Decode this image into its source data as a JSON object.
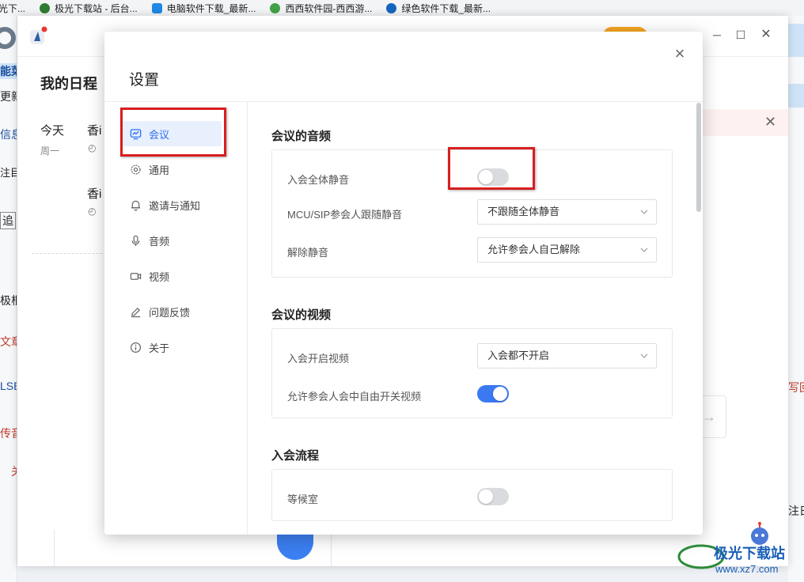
{
  "bookmarks": [
    {
      "label": "光下...",
      "color": "#f0b429"
    },
    {
      "label": "极光下载站 - 后台...",
      "color": "#2e7d32"
    },
    {
      "label": "电脑软件下载_最新...",
      "color": "#1e88e5"
    },
    {
      "label": "西西软件园-西西游...",
      "color": "#43a047"
    },
    {
      "label": "绿色软件下载_最新...",
      "color": "#1565c0"
    }
  ],
  "background": {
    "left_fragments": [
      "能菜",
      "更新",
      "信息",
      "注目.",
      "追",
      "极根",
      "文章",
      "LSE",
      "传音",
      "关"
    ],
    "right_fragments": [
      "写回",
      "注日打"
    ],
    "app": {
      "heading": "我的日程",
      "today": "今天",
      "weekday": "周一",
      "events": [
        "香i",
        "香i"
      ]
    }
  },
  "dialog": {
    "title": "设置",
    "nav": [
      {
        "label": "会议",
        "icon": "meeting-icon",
        "active": true
      },
      {
        "label": "通用",
        "icon": "gear-icon",
        "active": false
      },
      {
        "label": "邀请与通知",
        "icon": "bell-icon",
        "active": false
      },
      {
        "label": "音频",
        "icon": "microphone-icon",
        "active": false
      },
      {
        "label": "视频",
        "icon": "video-camera-icon",
        "active": false
      },
      {
        "label": "问题反馈",
        "icon": "pencil-icon",
        "active": false
      },
      {
        "label": "关于",
        "icon": "info-icon",
        "active": false
      }
    ],
    "audio": {
      "title": "会议的音频",
      "mute_on_join_label": "入会全体静音",
      "mute_on_join": false,
      "mcu_label": "MCU/SIP参会人跟随静音",
      "mcu_value": "不跟随全体静音",
      "unmute_label": "解除静音",
      "unmute_value": "允许参会人自己解除"
    },
    "video": {
      "title": "会议的视频",
      "video_on_join_label": "入会开启视频",
      "video_on_join_value": "入会都不开启",
      "allow_toggle_label": "允许参会人会中自由开关视频",
      "allow_toggle": true
    },
    "join_flow": {
      "title": "入会流程",
      "waiting_room_label": "等候室",
      "waiting_room": false
    }
  },
  "watermark": {
    "text": "极光下载站",
    "url": "www.xz7.com"
  },
  "colors": {
    "accent": "#3a79f0",
    "highlight": "#d81e1e",
    "toggle_off": "#d9dbde"
  }
}
